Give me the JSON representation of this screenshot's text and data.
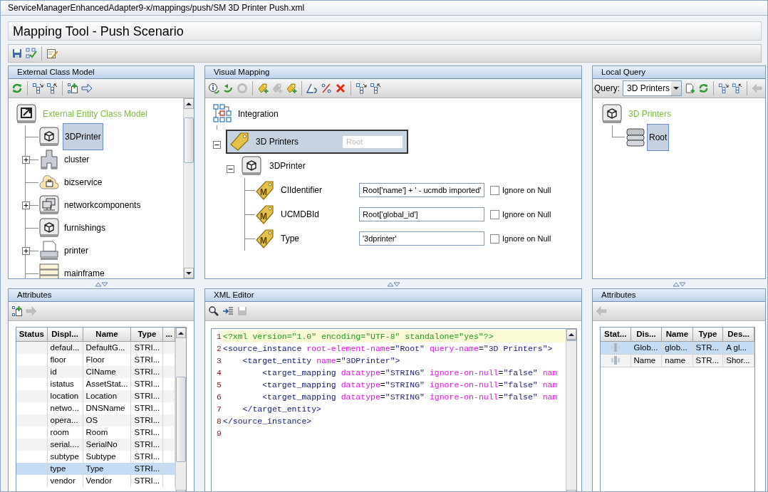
{
  "window": {
    "title": "ServiceManagerEnhancedAdapter9-x/mappings/push/SM 3D Printer Push.xml"
  },
  "app_title": "Mapping Tool - Push Scenario",
  "main_toolbar": [
    [
      {
        "kind": "save",
        "disabled": false
      },
      {
        "kind": "validate",
        "disabled": false
      }
    ],
    [
      {
        "kind": "edit",
        "disabled": false
      }
    ]
  ],
  "external_class_model": {
    "title": "External Class Model",
    "toolbar": [
      [
        {
          "kind": "refresh",
          "disabled": false
        }
      ],
      [
        {
          "kind": "expand",
          "disabled": false
        },
        {
          "kind": "collapse",
          "disabled": false
        }
      ],
      [
        {
          "kind": "add-node",
          "disabled": false
        },
        {
          "kind": "arrow-right",
          "disabled": false
        }
      ]
    ],
    "tree": {
      "label": "External Entity Class Model",
      "kind": "export",
      "children": [
        {
          "label": "3DPrinter",
          "kind": "cube",
          "selected": true,
          "expandable": false
        },
        {
          "label": "cluster",
          "kind": "cluster",
          "selected": false,
          "expandable": true
        },
        {
          "label": "bizservice",
          "kind": "bizservice",
          "selected": false,
          "expandable": false
        },
        {
          "label": "networkcomponents",
          "kind": "network",
          "selected": false,
          "expandable": true
        },
        {
          "label": "furnishings",
          "kind": "cube",
          "selected": false,
          "expandable": false
        },
        {
          "label": "printer",
          "kind": "printer",
          "selected": false,
          "expandable": true
        },
        {
          "label": "mainframe",
          "kind": "mainframe",
          "selected": false,
          "expandable": false
        }
      ]
    }
  },
  "visual_mapping": {
    "title": "Visual Mapping",
    "toolbar": [
      [
        {
          "kind": "info",
          "disabled": false
        },
        {
          "kind": "reload",
          "disabled": false
        },
        {
          "kind": "link",
          "disabled": true
        }
      ],
      [
        {
          "kind": "tag-add",
          "disabled": false
        },
        {
          "kind": "tag-add",
          "disabled": true
        },
        {
          "kind": "tag-add",
          "disabled": false
        }
      ],
      [
        {
          "kind": "triangle",
          "disabled": false
        },
        {
          "kind": "percent",
          "disabled": false
        },
        {
          "kind": "delete",
          "disabled": false
        }
      ],
      [
        {
          "kind": "expand",
          "disabled": false
        },
        {
          "kind": "collapse",
          "disabled": false
        }
      ]
    ],
    "integration": {
      "label": "Integration"
    },
    "query_node": {
      "label": "3D Printers",
      "placeholder": "Root",
      "selected": true,
      "expanded": true
    },
    "entity": {
      "label": "3DPrinter",
      "expanded": true
    },
    "mappings": [
      {
        "label": "CIIdentifier",
        "icon_letter": "M",
        "value": "Root['name'] + ' - ucmdb imported'",
        "ignore_on_null": false,
        "option_label": "Ignore on Null"
      },
      {
        "label": "UCMDBId",
        "icon_letter": "M",
        "value": "Root['global_id']",
        "ignore_on_null": false,
        "option_label": "Ignore on Null"
      },
      {
        "label": "Type",
        "icon_letter": "M",
        "value": "'3dprinter'",
        "ignore_on_null": false,
        "option_label": "Ignore on Null"
      }
    ]
  },
  "local_query": {
    "title": "Local Query",
    "query_label": "Query:",
    "query_value": "3D Printers",
    "toolbar": [
      [
        {
          "kind": "new-file",
          "disabled": false
        },
        {
          "kind": "refresh",
          "disabled": false
        }
      ],
      [
        {
          "kind": "expand",
          "disabled": false
        },
        {
          "kind": "collapse",
          "disabled": false
        }
      ],
      [
        {
          "kind": "arrow-left",
          "disabled": true
        }
      ]
    ],
    "tree": {
      "label": "3D Printers",
      "kind": "cube",
      "children": [
        {
          "label": "Root",
          "kind": "database",
          "selected": true
        }
      ]
    }
  },
  "class_attributes": {
    "title": "Attributes",
    "toolbar": [
      [
        {
          "kind": "add-node",
          "disabled": false
        },
        {
          "kind": "arrow-right",
          "disabled": true
        }
      ]
    ],
    "columns": [
      "Status",
      "Displ...",
      "Name",
      "Type",
      "..."
    ],
    "rows": [
      {
        "display": "defaul...",
        "name": "DefaultG...",
        "type": "STRI...",
        "selected": false
      },
      {
        "display": "floor",
        "name": "Floor",
        "type": "STRI...",
        "selected": false
      },
      {
        "display": "id",
        "name": "CIName",
        "type": "STRI...",
        "selected": false
      },
      {
        "display": "istatus",
        "name": "AssetStat...",
        "type": "STRI...",
        "selected": false
      },
      {
        "display": "location",
        "name": "Location",
        "type": "STRI...",
        "selected": false
      },
      {
        "display": "netwo...",
        "name": "DNSName",
        "type": "STRI...",
        "selected": false
      },
      {
        "display": "opera...",
        "name": "OS",
        "type": "STRI...",
        "selected": false
      },
      {
        "display": "room",
        "name": "Room",
        "type": "STRI...",
        "selected": false
      },
      {
        "display": "serial....",
        "name": "SerialNo",
        "type": "STRI...",
        "selected": false
      },
      {
        "display": "subtype",
        "name": "Subtype",
        "type": "STRI...",
        "selected": false
      },
      {
        "display": "type",
        "name": "Type",
        "type": "STRI...",
        "selected": true
      },
      {
        "display": "vendor",
        "name": "Vendor",
        "type": "STRI...",
        "selected": false
      }
    ]
  },
  "xml_editor": {
    "title": "XML Editor",
    "toolbar": [
      [
        {
          "kind": "search",
          "disabled": false
        },
        {
          "kind": "indent",
          "disabled": false
        },
        {
          "kind": "save",
          "disabled": true
        }
      ]
    ],
    "lines": [
      {
        "number": "1",
        "highlighted": true,
        "tokens": [
          {
            "kind": "decl",
            "text": "<?xml version=\"1.0\" encoding=\"UTF-8\" standalone=\"yes\"?>"
          }
        ]
      },
      {
        "number": "2",
        "highlighted": false,
        "tokens": [
          {
            "kind": "tag",
            "text": "<source_instance"
          },
          {
            "kind": "attr",
            "text": " root-element-name"
          },
          {
            "kind": "punct",
            "text": "="
          },
          {
            "kind": "value",
            "text": "\"Root\""
          },
          {
            "kind": "attr",
            "text": " query-name"
          },
          {
            "kind": "punct",
            "text": "="
          },
          {
            "kind": "value",
            "text": "\"3D Printers\""
          },
          {
            "kind": "tag",
            "text": ">"
          }
        ]
      },
      {
        "number": "3",
        "highlighted": false,
        "tokens": [
          {
            "kind": "tag",
            "text": "    <target_entity"
          },
          {
            "kind": "attr",
            "text": " name"
          },
          {
            "kind": "punct",
            "text": "="
          },
          {
            "kind": "value",
            "text": "\"3DPrinter\""
          },
          {
            "kind": "tag",
            "text": ">"
          }
        ]
      },
      {
        "number": "4",
        "highlighted": false,
        "tokens": [
          {
            "kind": "tag",
            "text": "        <target_mapping"
          },
          {
            "kind": "attr",
            "text": " datatype"
          },
          {
            "kind": "punct",
            "text": "="
          },
          {
            "kind": "value",
            "text": "\"STRING\""
          },
          {
            "kind": "attr",
            "text": " ignore-on-null"
          },
          {
            "kind": "punct",
            "text": "="
          },
          {
            "kind": "value",
            "text": "\"false\""
          },
          {
            "kind": "attr",
            "text": " nam"
          }
        ]
      },
      {
        "number": "5",
        "highlighted": false,
        "tokens": [
          {
            "kind": "tag",
            "text": "        <target_mapping"
          },
          {
            "kind": "attr",
            "text": " datatype"
          },
          {
            "kind": "punct",
            "text": "="
          },
          {
            "kind": "value",
            "text": "\"STRING\""
          },
          {
            "kind": "attr",
            "text": " ignore-on-null"
          },
          {
            "kind": "punct",
            "text": "="
          },
          {
            "kind": "value",
            "text": "\"false\""
          },
          {
            "kind": "attr",
            "text": " nam"
          }
        ]
      },
      {
        "number": "6",
        "highlighted": false,
        "tokens": [
          {
            "kind": "tag",
            "text": "        <target_mapping"
          },
          {
            "kind": "attr",
            "text": " datatype"
          },
          {
            "kind": "punct",
            "text": "="
          },
          {
            "kind": "value",
            "text": "\"STRING\""
          },
          {
            "kind": "attr",
            "text": " ignore-on-null"
          },
          {
            "kind": "punct",
            "text": "="
          },
          {
            "kind": "value",
            "text": "\"false\""
          },
          {
            "kind": "attr",
            "text": " nam"
          }
        ]
      },
      {
        "number": "7",
        "highlighted": false,
        "tokens": [
          {
            "kind": "tag",
            "text": "    </target_entity>"
          }
        ]
      },
      {
        "number": "8",
        "highlighted": false,
        "tokens": [
          {
            "kind": "tag",
            "text": "</source_instance>"
          }
        ]
      },
      {
        "number": "9",
        "highlighted": false
      }
    ]
  },
  "query_attributes": {
    "title": "Attributes",
    "toolbar": [
      [
        {
          "kind": "arrow-left",
          "disabled": true
        }
      ]
    ],
    "columns": [
      "Stat...",
      "Dis...",
      "Name",
      "Type",
      "Des..."
    ],
    "rows": [
      {
        "display": "Glob...",
        "name": "glob...",
        "type": "STR...",
        "description": "A gl...",
        "selected": true
      },
      {
        "display": "Name",
        "name": "name",
        "type": "STR...",
        "description": "Shor...",
        "selected": false
      }
    ]
  }
}
